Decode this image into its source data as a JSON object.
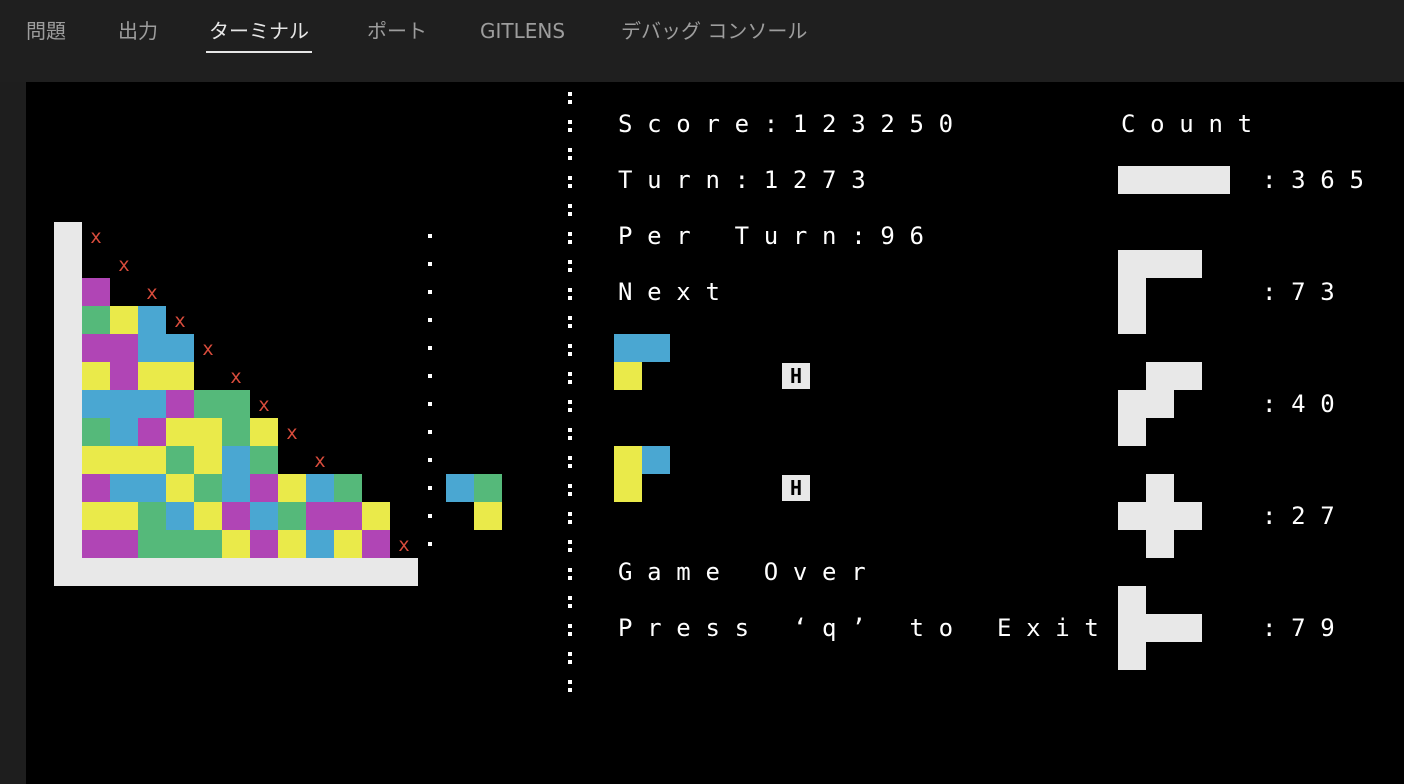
{
  "tabs": [
    {
      "label": "問題",
      "active": false
    },
    {
      "label": "出力",
      "active": false
    },
    {
      "label": "ターミナル",
      "active": true
    },
    {
      "label": "ポート",
      "active": false
    },
    {
      "label": "GITLENS",
      "active": false
    },
    {
      "label": "デバッグ コンソール",
      "active": false
    }
  ],
  "colors": {
    "purple": "#b045b5",
    "green": "#55b97a",
    "yellow": "#eaea4a",
    "blue": "#4aa7d2",
    "wall": "#e8e8e8",
    "marker": "#d94c3c",
    "background": "#000000"
  },
  "game": {
    "score_label": "Score:123250",
    "turn_label": "Turn:1273",
    "per_turn_label": "Per Turn:96",
    "next_label": "Next",
    "count_label": "Count",
    "game_over": "Game Over",
    "exit_hint": "Press ‘q’ to Exit",
    "hold_marker": "H",
    "miss_marker": "x",
    "counts": [
      {
        "piece": "bar",
        "value": ":365"
      },
      {
        "piece": "corner",
        "value": ":73"
      },
      {
        "piece": "zigzag",
        "value": ":40"
      },
      {
        "piece": "plus",
        "value": ":27"
      },
      {
        "piece": "tee",
        "value": ":79"
      }
    ]
  }
}
